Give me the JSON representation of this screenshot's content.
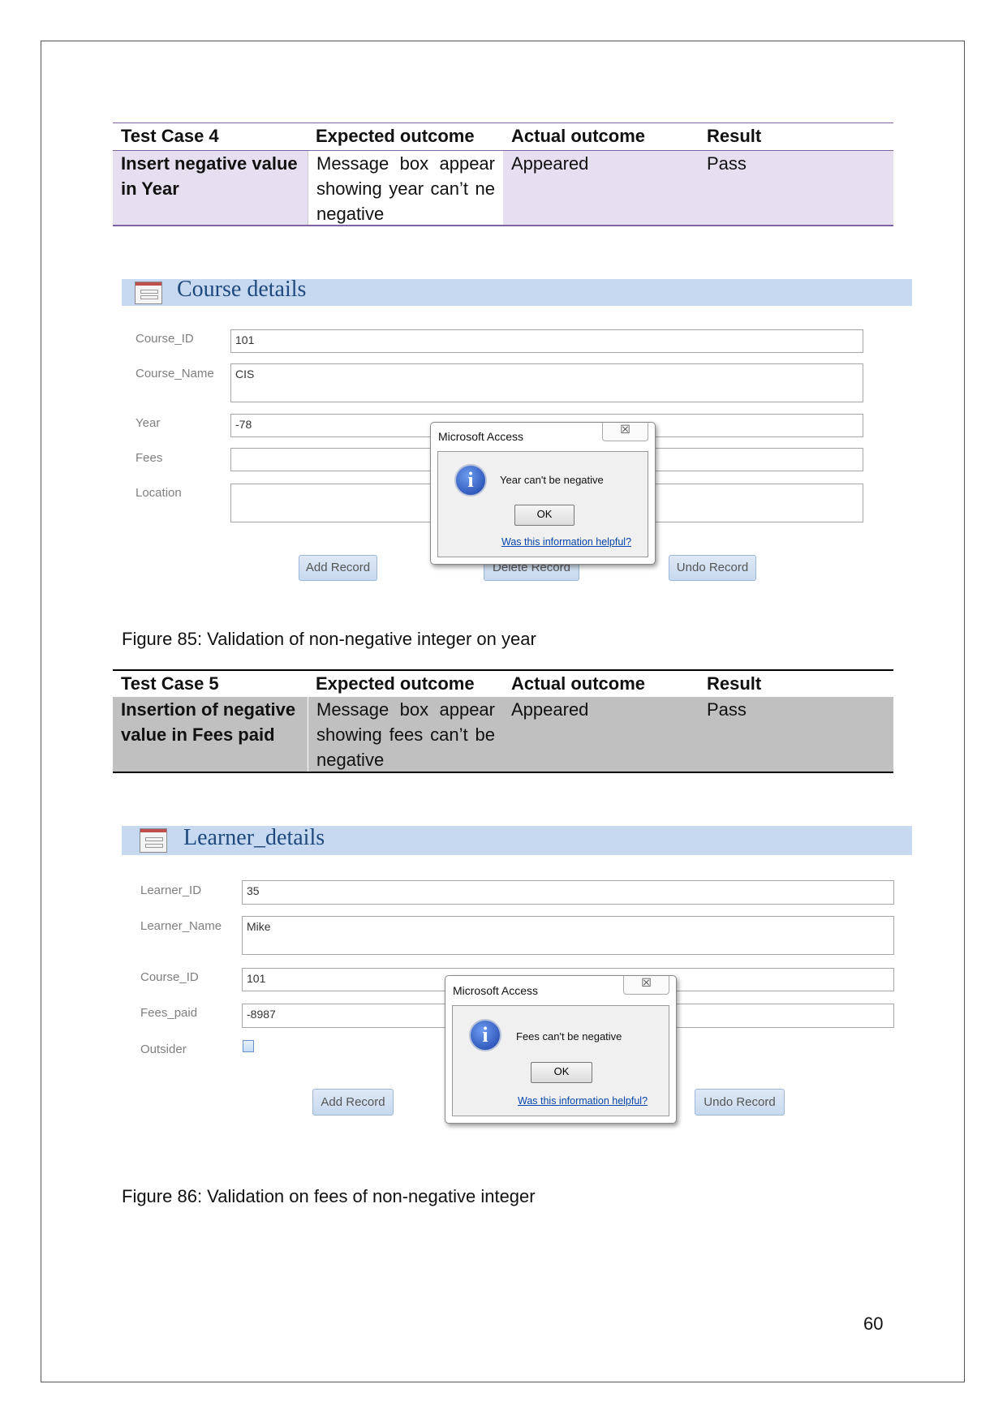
{
  "table1": {
    "headers": [
      "Test Case 4",
      "Expected outcome",
      "Actual outcome",
      "Result"
    ],
    "row": [
      "Insert negative value in Year",
      "Message box appear showing year can’t ne negative",
      "Appeared",
      "Pass"
    ],
    "row_bg": "#e5dff0"
  },
  "form1": {
    "title": "Course details",
    "fields": [
      {
        "label": "Course_ID",
        "value": "101"
      },
      {
        "label": "Course_Name",
        "value": "CIS"
      },
      {
        "label": "Year",
        "value": "-78"
      },
      {
        "label": "Fees",
        "value": ""
      },
      {
        "label": "Location",
        "value": ""
      }
    ],
    "buttons": [
      "Add Record",
      "Delete Record",
      "Undo Record"
    ],
    "dialog": {
      "title": "Microsoft Access",
      "close": "☒",
      "message": "Year can't be negative",
      "ok": "OK",
      "help": "Was this information helpful?"
    }
  },
  "caption1": "Figure 85: Validation of non-negative integer on year",
  "table2": {
    "headers": [
      "Test Case 5",
      "Expected outcome",
      "Actual outcome",
      "Result"
    ],
    "row": [
      "Insertion of negative value in Fees paid",
      "Message box appear showing fees can’t be negative",
      "Appeared",
      "Pass"
    ],
    "row_bg": "#c0c0c0"
  },
  "form2": {
    "title": "Learner_details",
    "fields": [
      {
        "label": "Learner_ID",
        "value": "35"
      },
      {
        "label": "Learner_Name",
        "value": "Mike"
      },
      {
        "label": "Course_ID",
        "value": "101"
      },
      {
        "label": "Fees_paid",
        "value": "-8987"
      },
      {
        "label": "Outsider",
        "value": ""
      }
    ],
    "outsider_checked": false,
    "buttons": [
      "Add Record",
      "Undo Record"
    ],
    "dialog": {
      "title": "Microsoft Access",
      "close": "☒",
      "message": "Fees can't be negative",
      "ok": "OK",
      "help": "Was this information helpful?"
    }
  },
  "caption2": "Figure 86: Validation on fees of non-negative integer",
  "page_number": "60",
  "colors": {
    "form_header": "#c6d9f1",
    "form_title": "#1f497d"
  }
}
